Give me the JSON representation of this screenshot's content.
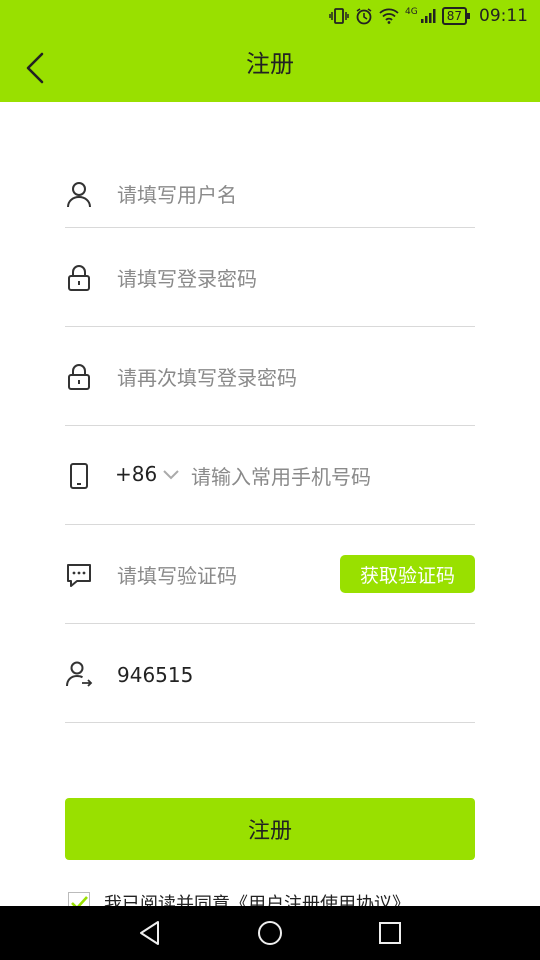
{
  "status_bar": {
    "battery": "87",
    "network": "4G",
    "time": "09:11"
  },
  "header": {
    "title": "注册",
    "back_icon": "chevron-left-icon"
  },
  "form": {
    "username": {
      "placeholder": "请填写用户名",
      "icon": "user-icon"
    },
    "password": {
      "placeholder": "请填写登录密码",
      "icon": "lock-icon"
    },
    "confirm_password": {
      "placeholder": "请再次填写登录密码",
      "icon": "lock-icon"
    },
    "phone": {
      "country_code": "+86",
      "placeholder": "请输入常用手机号码",
      "icon": "phone-icon"
    },
    "verify_code": {
      "placeholder": "请填写验证码",
      "button_label": "获取验证码",
      "icon": "message-icon"
    },
    "invite_code": {
      "value": "946515",
      "icon": "user-arrow-icon"
    }
  },
  "submit_label": "注册",
  "agreement": {
    "text": "我已阅读并同意",
    "link": "《用户注册使用协议》",
    "checked": true
  },
  "colors": {
    "accent": "#99e000",
    "text": "#222222",
    "placeholder": "#8a8a8a",
    "divider": "#d9d9d9"
  }
}
